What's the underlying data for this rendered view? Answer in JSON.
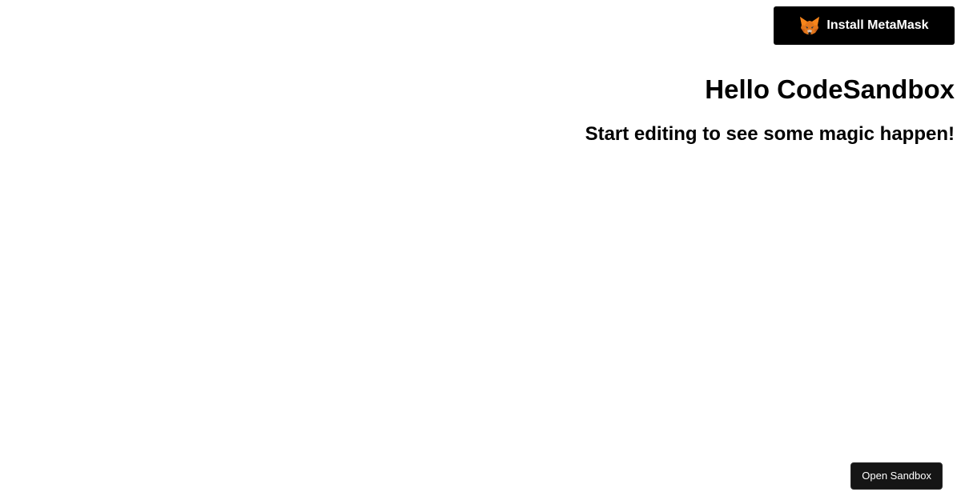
{
  "header": {
    "install_button_label": "Install MetaMask",
    "install_button_icon": "metamask-fox-icon"
  },
  "main": {
    "title": "Hello CodeSandbox",
    "subtitle": "Start editing to see some magic happen!"
  },
  "footer": {
    "open_sandbox_label": "Open Sandbox"
  },
  "colors": {
    "background": "#ffffff",
    "button_background": "#000000",
    "button_text": "#ffffff",
    "fox_primary": "#e2761b",
    "fox_dark": "#763d16",
    "fox_light": "#f6851b"
  }
}
